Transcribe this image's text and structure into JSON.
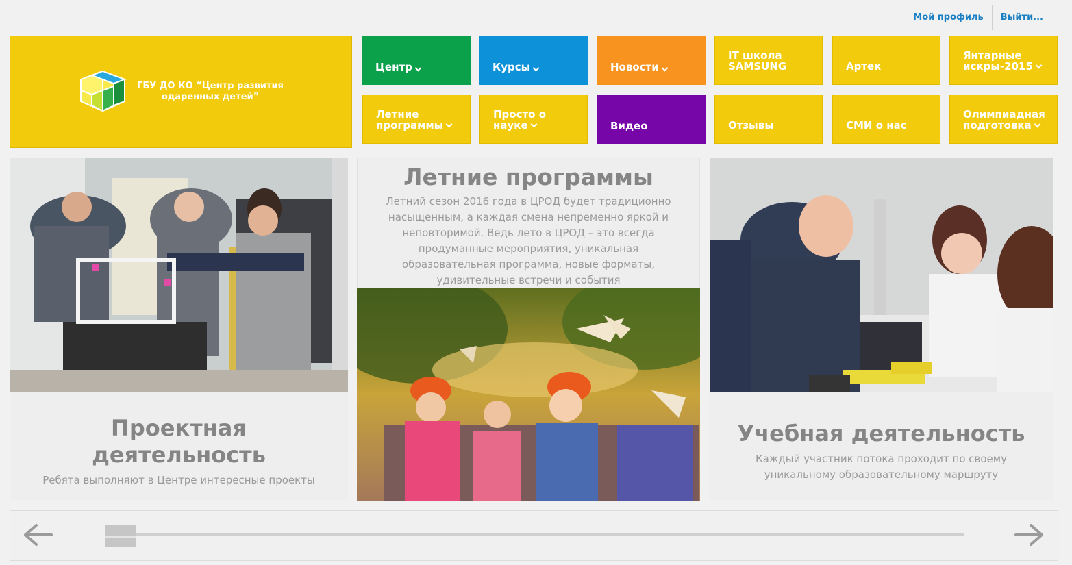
{
  "header": {
    "profile_link": "Мой профиль",
    "logout_link": "Выйти..."
  },
  "logo": {
    "text_line1": "ГБУ ДО КО “Центр развития",
    "text_line2": "одаренных детей”"
  },
  "nav": {
    "tiles": [
      {
        "label": "Центр",
        "color": "#0ba14b",
        "dropdown": true
      },
      {
        "label": "Курсы",
        "color": "#0d92d9",
        "dropdown": true
      },
      {
        "label": "Новости",
        "color": "#f7931e",
        "dropdown": true
      },
      {
        "label": "IT школа\nSAMSUNG",
        "color": "#f2cb0c",
        "dropdown": false
      },
      {
        "label": "Артек",
        "color": "#f2cb0c",
        "dropdown": false
      },
      {
        "label": "Янтарные\nискры-2015",
        "color": "#f2cb0c",
        "dropdown": true
      },
      {
        "label": "Летние\nпрограммы",
        "color": "#f2cb0c",
        "dropdown": true
      },
      {
        "label": "Просто о\nнауке",
        "color": "#f2cb0c",
        "dropdown": true
      },
      {
        "label": "Видео",
        "color": "#7606a8",
        "dropdown": false
      },
      {
        "label": "Отзывы",
        "color": "#f2cb0c",
        "dropdown": false
      },
      {
        "label": "СМИ о нас",
        "color": "#f2cb0c",
        "dropdown": false
      },
      {
        "label": "Олимпиадная\nподготовка",
        "color": "#f2cb0c",
        "dropdown": true
      }
    ]
  },
  "cards": {
    "project": {
      "title_line1": "Проектная",
      "title_line2": "деятельность",
      "text": "Ребята выполняют в Центре интересные проекты"
    },
    "summer": {
      "title": "Летние программы",
      "text": "Летний сезон 2016 года в ЦРОД будет традиционно насыщенным, а каждая смена непременно яркой и неповторимой. Ведь лето в ЦРОД – это всегда продуманные мероприятия, уникальная образовательная программа, новые форматы, удивительные встречи и события"
    },
    "study": {
      "title": "Учебная деятельность",
      "text": "Каждый участник потока проходит по своему уникальному образовательному маршруту"
    }
  },
  "slider": {
    "prev_icon": "arrow-left-icon",
    "next_icon": "arrow-right-icon"
  }
}
